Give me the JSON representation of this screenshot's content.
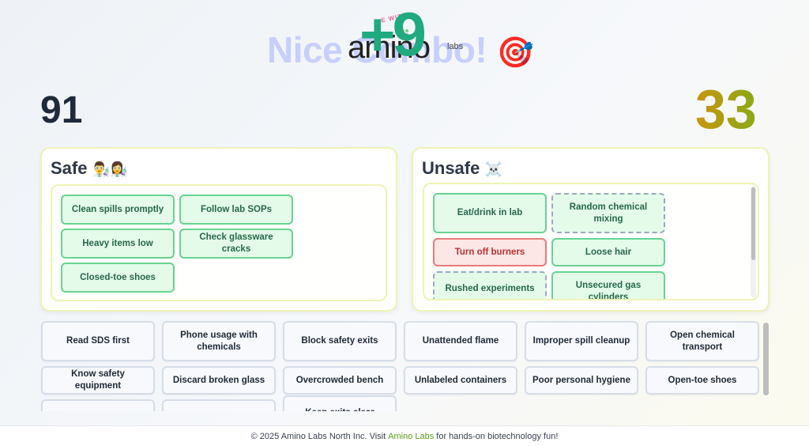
{
  "header": {
    "combo_text": "Nice Combo!",
    "combo_emoji": "🎯",
    "bonus": "+9",
    "logo_word": "amino",
    "logo_suffix": "labs",
    "logo_tagline": "E WITH"
  },
  "scores": {
    "left": "91",
    "right": "33"
  },
  "safe": {
    "title": "Safe",
    "emoji": "👨‍🔬👩‍🔬",
    "cards": [
      {
        "label": "Clean spills promptly"
      },
      {
        "label": "Follow lab SOPs"
      },
      {
        "label": "Heavy items low"
      },
      {
        "label": "Check glassware cracks"
      },
      {
        "label": "Closed-toe shoes"
      }
    ]
  },
  "unsafe": {
    "title": "Unsafe",
    "emoji": "☠️",
    "cards": [
      {
        "label": "Eat/drink in lab",
        "state": "placed"
      },
      {
        "label": "Random chemical mixing",
        "state": "dashed"
      },
      {
        "label": "Turn off burners",
        "state": "wrong"
      },
      {
        "label": "Loose hair",
        "state": "placed"
      },
      {
        "label": "Rushed experiments",
        "state": "dashed"
      },
      {
        "label": "Unsecured gas cylinders",
        "state": "placed"
      }
    ]
  },
  "pool": [
    "Read SDS first",
    "Phone usage with chemicals",
    "Block safety exits",
    "Unattended flame",
    "Improper spill cleanup",
    "Open chemical transport",
    "Know safety equipment",
    "Discard broken glass",
    "Overcrowded bench",
    "Unlabeled containers",
    "Poor personal hygiene",
    "Open-toe shoes",
    "",
    "",
    "Keep exits clear"
  ],
  "footer": {
    "prefix": "© 2025 Amino Labs North Inc. Visit",
    "link": "Amino Labs",
    "suffix": "for hands-on biotechnology fun!"
  },
  "colors": {
    "bonus": "#1faa7f",
    "combo": "#c7cffb",
    "placed_bg": "#e4fbea",
    "placed_border": "#68d391",
    "wrong_bg": "#fde6e6",
    "wrong_border": "#e87a7a",
    "link": "#5a9e1a"
  }
}
